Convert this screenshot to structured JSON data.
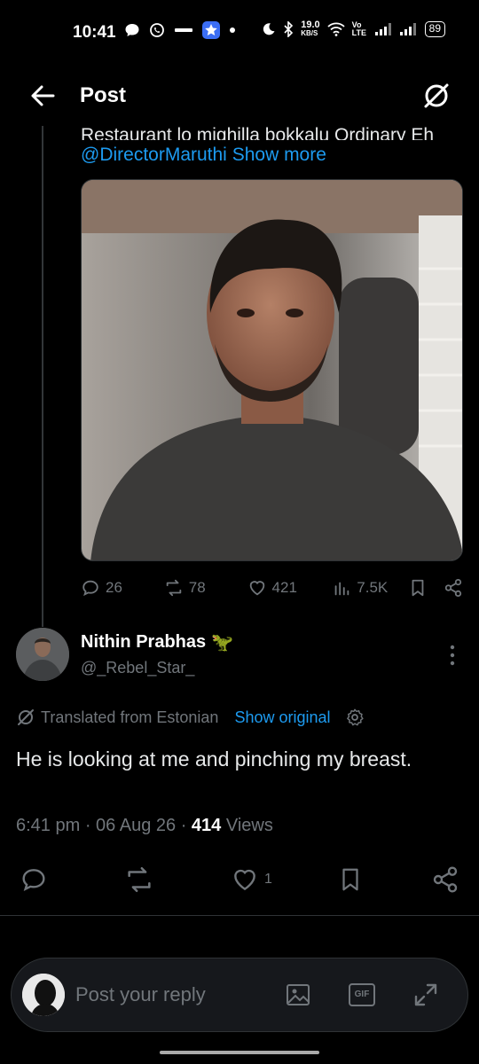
{
  "status_bar": {
    "time": "10:41",
    "net_speed": "19.0",
    "net_unit": "KB/S",
    "network_label": "Vo LTE",
    "battery": "89"
  },
  "header": {
    "title": "Post"
  },
  "parent_post": {
    "clipped_text": "Restaurant lo mighilla bokkalu Ordinary Eh",
    "mention": "@DirectorMaruthi",
    "show_more": "Show more",
    "metrics": {
      "replies": "26",
      "reposts": "78",
      "likes": "421",
      "views": "7.5K"
    }
  },
  "reply": {
    "author_name": "Nithin Prabhas",
    "author_emoji": "🦖",
    "handle": "@_Rebel_Star_",
    "translated_label": "Translated from Estonian",
    "show_original": "Show original",
    "text": "He is looking at me and pinching my breast.",
    "time": "6:41 pm",
    "date": "06 Aug 26",
    "views_count": "414",
    "views_label": "Views",
    "likes": "1"
  },
  "composer": {
    "placeholder": "Post your reply",
    "gif_label": "GIF"
  },
  "colors": {
    "accent": "#1d9bf0",
    "muted": "#71767b",
    "text": "#e7e9ea",
    "background": "#000000"
  }
}
